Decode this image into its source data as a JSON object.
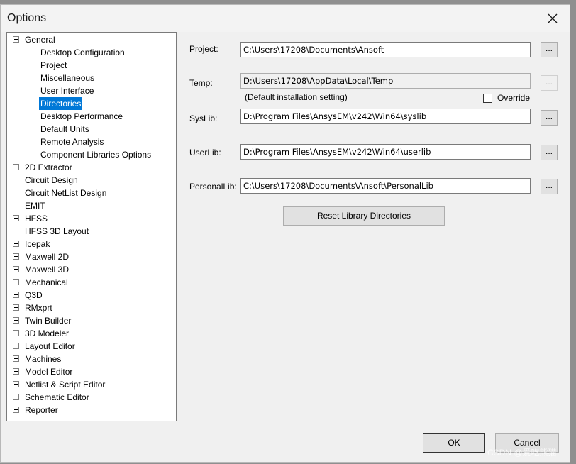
{
  "window": {
    "title": "Options"
  },
  "tree": {
    "items": [
      {
        "label": "General",
        "level": 0,
        "expander": "minus",
        "selected": false
      },
      {
        "label": "Desktop Configuration",
        "level": 1,
        "expander": "none",
        "selected": false
      },
      {
        "label": "Project",
        "level": 1,
        "expander": "none",
        "selected": false
      },
      {
        "label": "Miscellaneous",
        "level": 1,
        "expander": "none",
        "selected": false
      },
      {
        "label": "User Interface",
        "level": 1,
        "expander": "none",
        "selected": false
      },
      {
        "label": "Directories",
        "level": 1,
        "expander": "none",
        "selected": true
      },
      {
        "label": "Desktop Performance",
        "level": 1,
        "expander": "none",
        "selected": false
      },
      {
        "label": "Default Units",
        "level": 1,
        "expander": "none",
        "selected": false
      },
      {
        "label": "Remote Analysis",
        "level": 1,
        "expander": "none",
        "selected": false
      },
      {
        "label": "Component Libraries Options",
        "level": 1,
        "expander": "none",
        "selected": false
      },
      {
        "label": "2D Extractor",
        "level": 0,
        "expander": "plus",
        "selected": false
      },
      {
        "label": "Circuit Design",
        "level": 0,
        "expander": "none",
        "selected": false
      },
      {
        "label": "Circuit NetList Design",
        "level": 0,
        "expander": "none",
        "selected": false
      },
      {
        "label": "EMIT",
        "level": 0,
        "expander": "none",
        "selected": false
      },
      {
        "label": "HFSS",
        "level": 0,
        "expander": "plus",
        "selected": false
      },
      {
        "label": "HFSS 3D Layout",
        "level": 0,
        "expander": "none",
        "selected": false
      },
      {
        "label": "Icepak",
        "level": 0,
        "expander": "plus",
        "selected": false
      },
      {
        "label": "Maxwell 2D",
        "level": 0,
        "expander": "plus",
        "selected": false
      },
      {
        "label": "Maxwell 3D",
        "level": 0,
        "expander": "plus",
        "selected": false
      },
      {
        "label": "Mechanical",
        "level": 0,
        "expander": "plus",
        "selected": false
      },
      {
        "label": "Q3D",
        "level": 0,
        "expander": "plus",
        "selected": false
      },
      {
        "label": "RMxprt",
        "level": 0,
        "expander": "plus",
        "selected": false
      },
      {
        "label": "Twin Builder",
        "level": 0,
        "expander": "plus",
        "selected": false
      },
      {
        "label": "3D Modeler",
        "level": 0,
        "expander": "plus",
        "selected": false
      },
      {
        "label": "Layout Editor",
        "level": 0,
        "expander": "plus",
        "selected": false
      },
      {
        "label": "Machines",
        "level": 0,
        "expander": "plus",
        "selected": false
      },
      {
        "label": "Model Editor",
        "level": 0,
        "expander": "plus",
        "selected": false
      },
      {
        "label": "Netlist & Script Editor",
        "level": 0,
        "expander": "plus",
        "selected": false
      },
      {
        "label": "Schematic Editor",
        "level": 0,
        "expander": "plus",
        "selected": false
      },
      {
        "label": "Reporter",
        "level": 0,
        "expander": "plus",
        "selected": false
      }
    ]
  },
  "directories": {
    "project": {
      "label": "Project:",
      "value": "C:\\Users\\17208\\Documents\\Ansoft",
      "browse": "..."
    },
    "temp": {
      "label": "Temp:",
      "value": "D:\\Users\\17208\\AppData\\Local\\Temp",
      "browse": "...",
      "note": "(Default installation setting)",
      "override_label": "Override",
      "override_checked": false
    },
    "syslib": {
      "label": "SysLib:",
      "value": "D:\\Program Files\\AnsysEM\\v242\\Win64\\syslib",
      "browse": "..."
    },
    "userlib": {
      "label": "UserLib:",
      "value": "D:\\Program Files\\AnsysEM\\v242\\Win64\\userlib",
      "browse": "..."
    },
    "personallib": {
      "label": "PersonalLib:",
      "value": "C:\\Users\\17208\\Documents\\Ansoft\\PersonalLib",
      "browse": "..."
    },
    "reset_button": "Reset Library Directories"
  },
  "footer": {
    "ok": "OK",
    "cancel": "Cancel"
  },
  "watermark": "CSDN @爱吃熊猫",
  "colors": {
    "selection": "#0078d7",
    "dialog_bg": "#f0f0f0"
  }
}
